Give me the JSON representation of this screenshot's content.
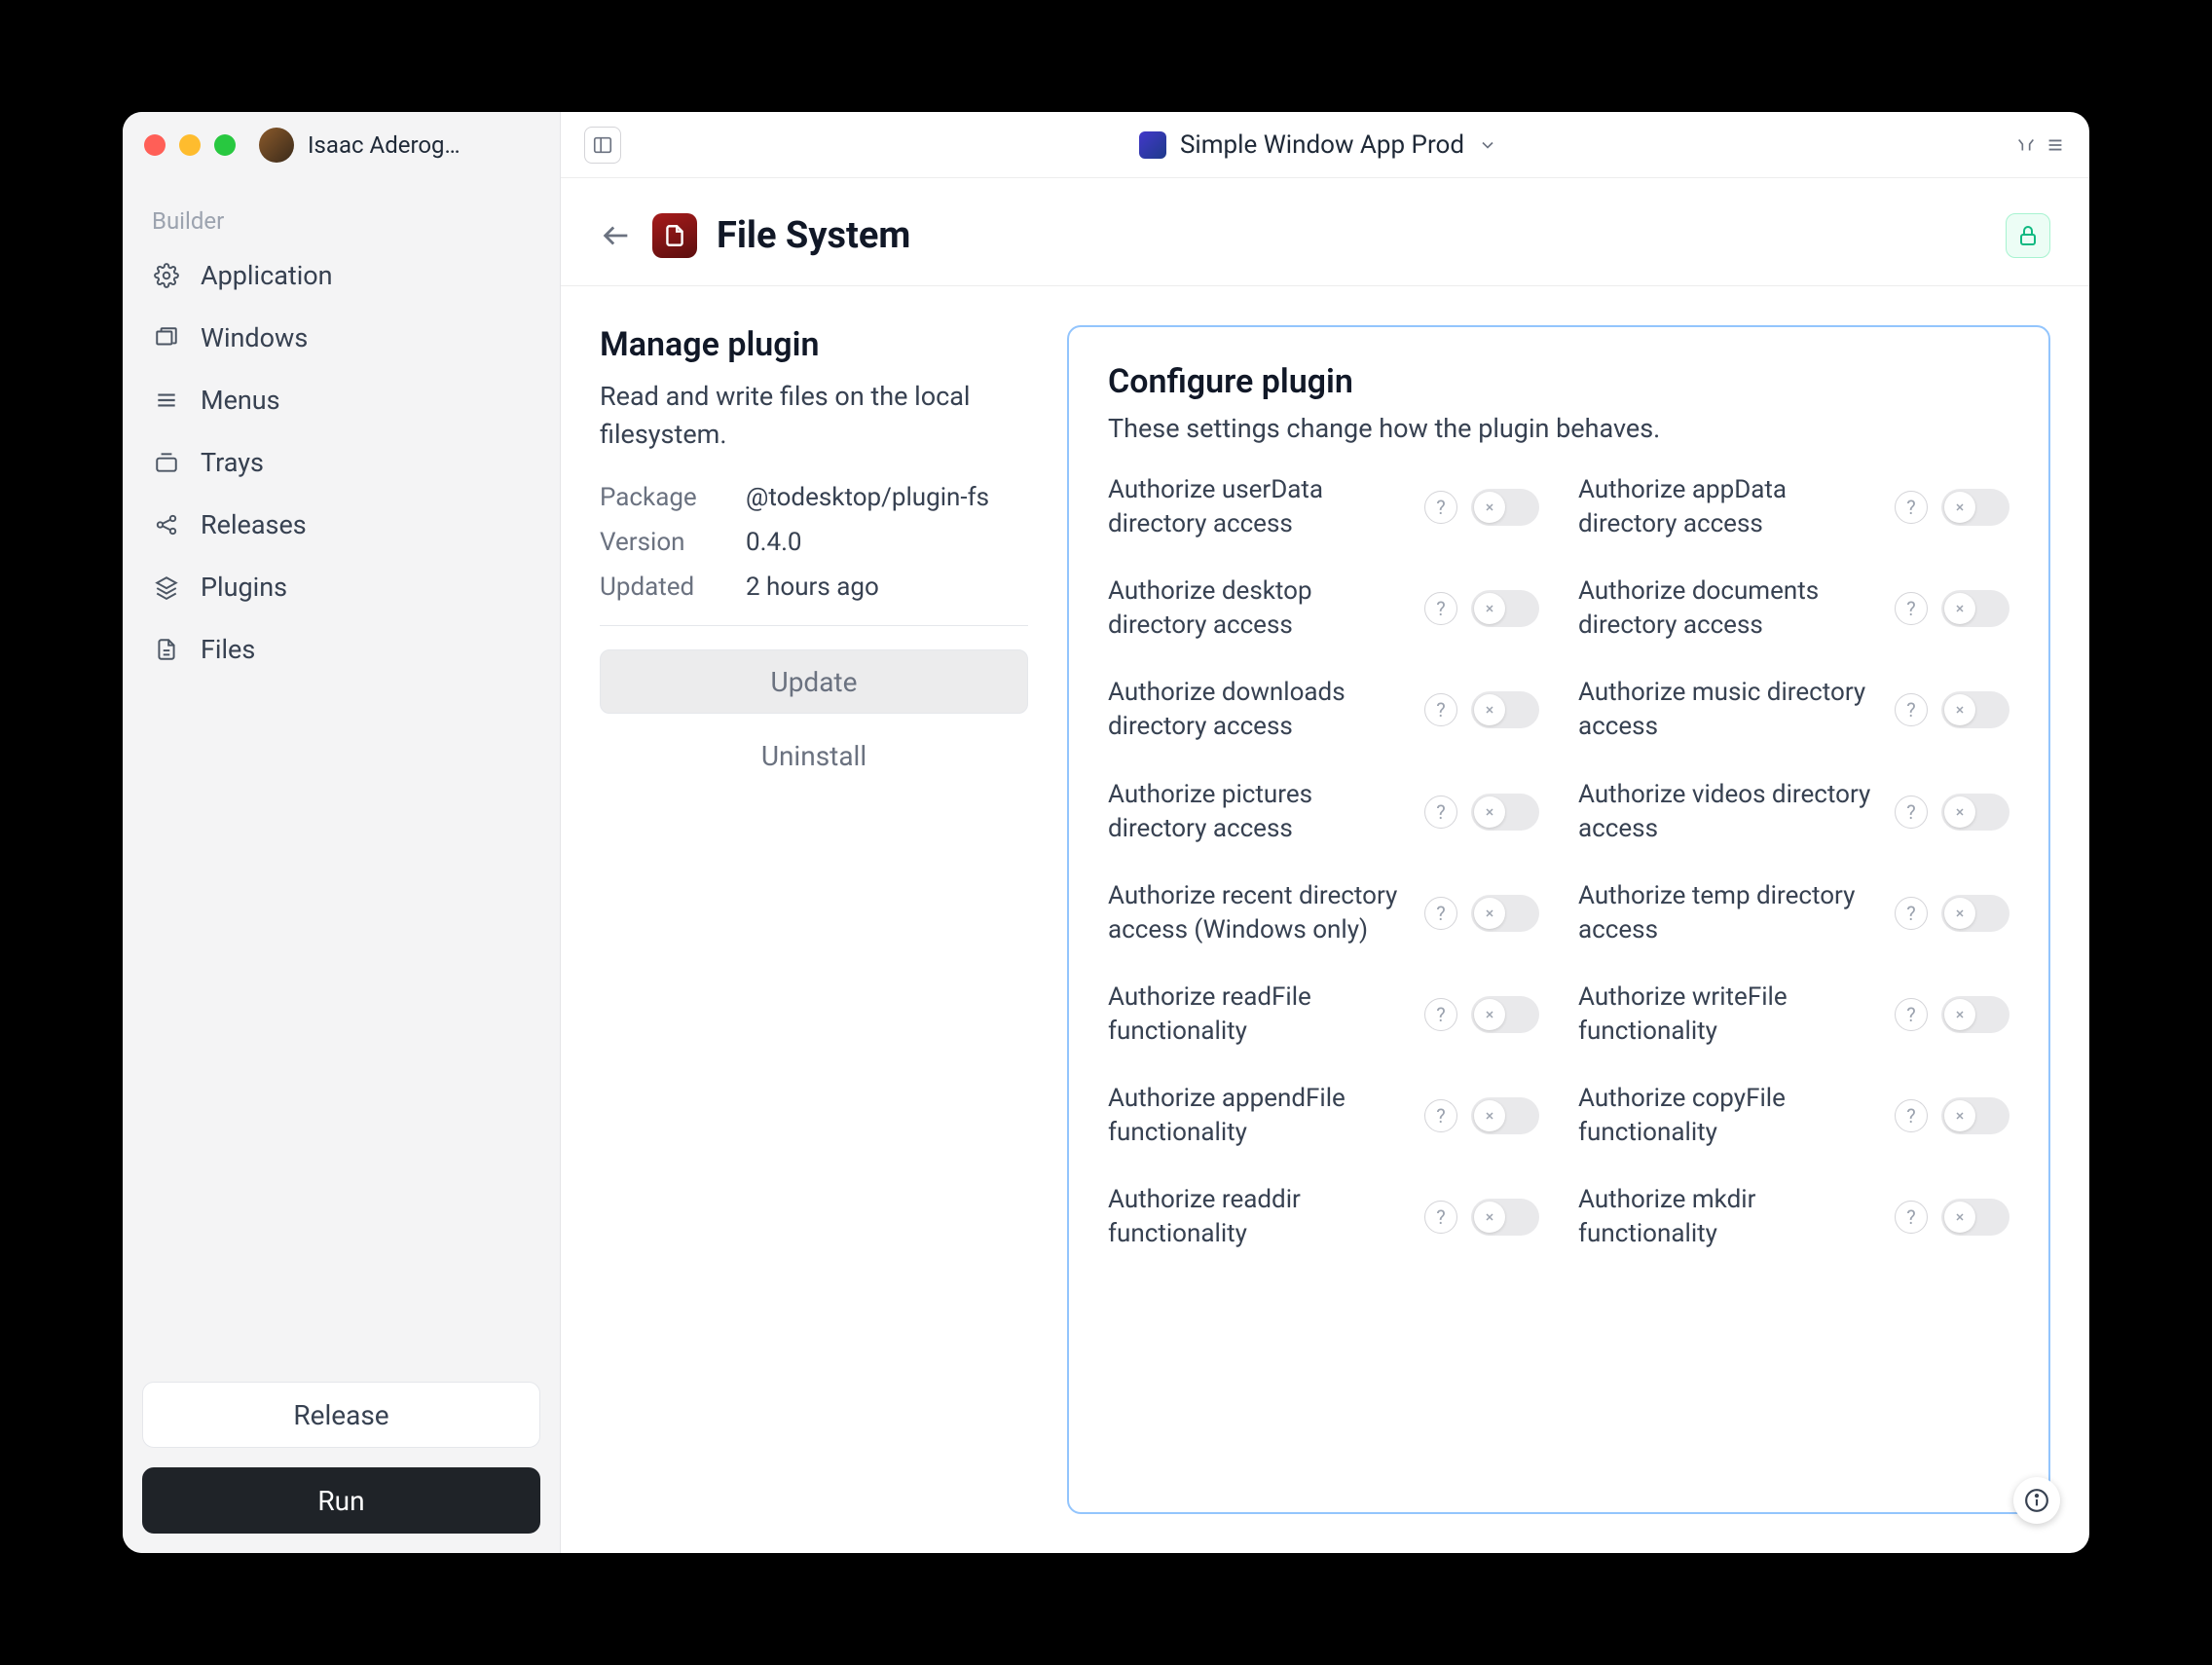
{
  "user": {
    "name": "Isaac Aderog…"
  },
  "app": {
    "title": "Simple Window App Prod"
  },
  "sidebar": {
    "section_label": "Builder",
    "items": [
      {
        "label": "Application"
      },
      {
        "label": "Windows"
      },
      {
        "label": "Menus"
      },
      {
        "label": "Trays"
      },
      {
        "label": "Releases"
      },
      {
        "label": "Plugins"
      },
      {
        "label": "Files"
      }
    ],
    "release_label": "Release",
    "run_label": "Run"
  },
  "page": {
    "title": "File System"
  },
  "manage": {
    "heading": "Manage plugin",
    "description": "Read and write files on the local filesystem.",
    "package_label": "Package",
    "package_value": "@todesktop/plugin-fs",
    "version_label": "Version",
    "version_value": "0.4.0",
    "updated_label": "Updated",
    "updated_value": "2 hours ago",
    "update_button": "Update",
    "uninstall_button": "Uninstall"
  },
  "configure": {
    "heading": "Configure plugin",
    "description": "These settings change how the plugin behaves.",
    "help_glyph": "?",
    "settings": [
      {
        "label": "Authorize userData directory access"
      },
      {
        "label": "Authorize appData directory access"
      },
      {
        "label": "Authorize desktop directory access"
      },
      {
        "label": "Authorize documents directory access"
      },
      {
        "label": "Authorize downloads directory access"
      },
      {
        "label": "Authorize music directory access"
      },
      {
        "label": "Authorize pictures directory access"
      },
      {
        "label": "Authorize videos directory access"
      },
      {
        "label": "Authorize recent directory access (Windows only)"
      },
      {
        "label": "Authorize temp directory access"
      },
      {
        "label": "Authorize readFile functionality"
      },
      {
        "label": "Authorize writeFile functionality"
      },
      {
        "label": "Authorize appendFile functionality"
      },
      {
        "label": "Authorize copyFile functionality"
      },
      {
        "label": "Authorize readdir functionality"
      },
      {
        "label": "Authorize mkdir functionality"
      }
    ]
  }
}
